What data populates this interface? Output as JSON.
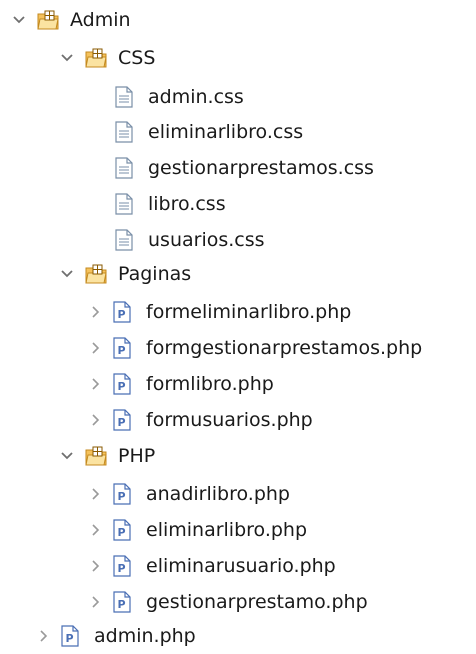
{
  "tree": {
    "admin_folder": {
      "label": "Admin",
      "icon": "package-folder-icon",
      "state": "expanded"
    },
    "css_folder": {
      "label": "CSS",
      "icon": "package-folder-icon",
      "state": "expanded"
    },
    "css_files": [
      {
        "label": "admin.css",
        "icon": "css-file-icon"
      },
      {
        "label": "eliminarlibro.css",
        "icon": "css-file-icon"
      },
      {
        "label": "gestionarprestamos.css",
        "icon": "css-file-icon"
      },
      {
        "label": "libro.css",
        "icon": "css-file-icon"
      },
      {
        "label": "usuarios.css",
        "icon": "css-file-icon"
      }
    ],
    "paginas_folder": {
      "label": "Paginas",
      "icon": "package-folder-icon",
      "state": "expanded"
    },
    "paginas_files": [
      {
        "label": "formeliminarlibro.php",
        "icon": "php-file-icon",
        "state": "collapsed"
      },
      {
        "label": "formgestionarprestamos.php",
        "icon": "php-file-icon",
        "state": "collapsed"
      },
      {
        "label": "formlibro.php",
        "icon": "php-file-icon",
        "state": "collapsed"
      },
      {
        "label": "formusuarios.php",
        "icon": "php-file-icon",
        "state": "collapsed"
      }
    ],
    "php_folder": {
      "label": "PHP",
      "icon": "package-folder-icon",
      "state": "expanded"
    },
    "php_files": [
      {
        "label": "anadirlibro.php",
        "icon": "php-file-icon",
        "state": "collapsed"
      },
      {
        "label": "eliminarlibro.php",
        "icon": "php-file-icon",
        "state": "collapsed"
      },
      {
        "label": "eliminarusuario.php",
        "icon": "php-file-icon",
        "state": "collapsed"
      },
      {
        "label": "gestionarprestamo.php",
        "icon": "php-file-icon",
        "state": "collapsed"
      }
    ],
    "root_file": {
      "label": "admin.php",
      "icon": "php-file-icon",
      "state": "collapsed"
    }
  },
  "colors": {
    "chevron": "#6f6f6f",
    "folder_fill": "#f5c25c",
    "folder_edge": "#c48a1f",
    "php_icon": "#4a6fb5",
    "css_icon": "#7a8fa8"
  }
}
